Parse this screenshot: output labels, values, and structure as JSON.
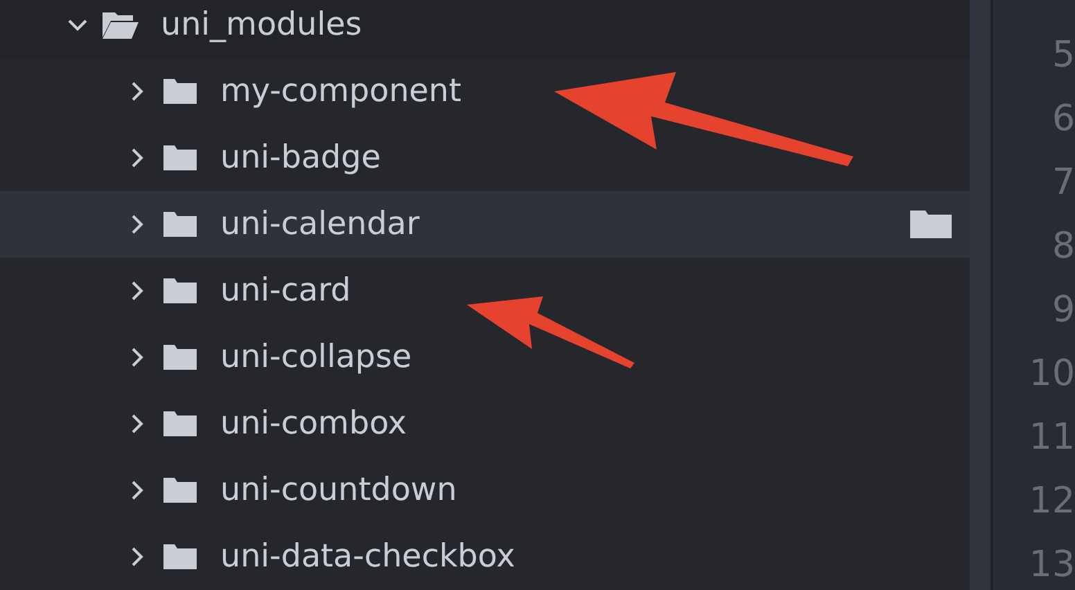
{
  "tree": {
    "name": "uni_modules",
    "expanded": true,
    "hovered": false,
    "children": [
      {
        "name": "my-component",
        "expanded": false,
        "hovered": false
      },
      {
        "name": "uni-badge",
        "expanded": false,
        "hovered": false
      },
      {
        "name": "uni-calendar",
        "expanded": false,
        "hovered": true
      },
      {
        "name": "uni-card",
        "expanded": false,
        "hovered": false
      },
      {
        "name": "uni-collapse",
        "expanded": false,
        "hovered": false
      },
      {
        "name": "uni-combox",
        "expanded": false,
        "hovered": false
      },
      {
        "name": "uni-countdown",
        "expanded": false,
        "hovered": false
      },
      {
        "name": "uni-data-checkbox",
        "expanded": false,
        "hovered": false
      }
    ]
  },
  "gutter": {
    "line_numbers": [
      "5",
      "6",
      "7",
      "8",
      "9",
      "10",
      "11",
      "12",
      "13"
    ]
  }
}
